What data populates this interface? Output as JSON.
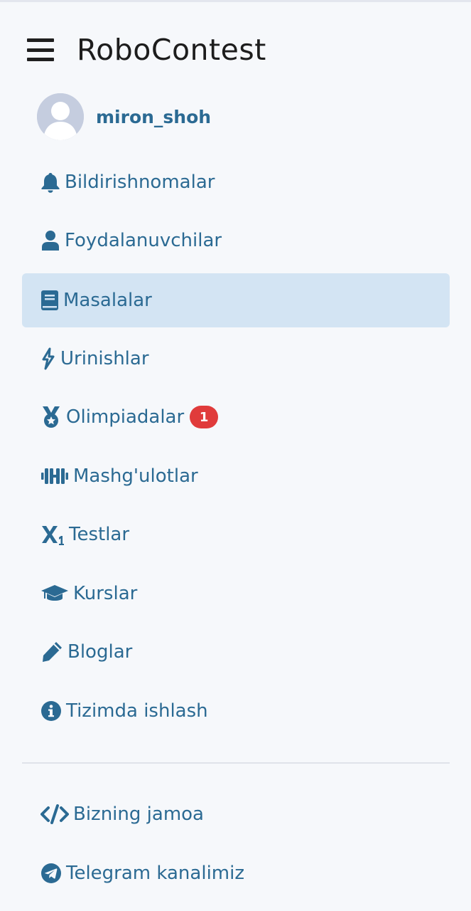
{
  "app": {
    "title": "RoboContest",
    "menu_icon": "hamburger-menu-icon"
  },
  "user": {
    "username": "miron_shoh",
    "avatar_icon": "user-avatar-placeholder"
  },
  "nav": {
    "items": [
      {
        "label": "Bildirishnomalar",
        "icon": "bell-icon",
        "active": false
      },
      {
        "label": "Foydalanuvchilar",
        "icon": "user-icon",
        "active": false
      },
      {
        "label": "Masalalar",
        "icon": "book-icon",
        "active": true
      },
      {
        "label": "Urinishlar",
        "icon": "activity-icon",
        "active": false
      },
      {
        "label": "Olimpiadalar",
        "icon": "medal-icon",
        "active": false,
        "badge": "1"
      },
      {
        "label": "Mashg'ulotlar",
        "icon": "dumbbell-icon",
        "active": false
      },
      {
        "label": "Testlar",
        "icon": "subscript-icon",
        "active": false
      },
      {
        "label": "Kurslar",
        "icon": "graduation-cap-icon",
        "active": false
      },
      {
        "label": "Bloglar",
        "icon": "pencil-icon",
        "active": false
      },
      {
        "label": "Tizimda ishlash",
        "icon": "info-circle-icon",
        "active": false
      }
    ],
    "footer_items": [
      {
        "label": "Bizning jamoa",
        "icon": "code-icon"
      },
      {
        "label": "Telegram kanalimiz",
        "icon": "telegram-icon"
      }
    ]
  },
  "colors": {
    "background": "#f6f8fb",
    "accent": "#2b6a93",
    "active_bg": "#d3e4f3",
    "badge": "#e03b3b",
    "text_dark": "#1d1d1d"
  }
}
